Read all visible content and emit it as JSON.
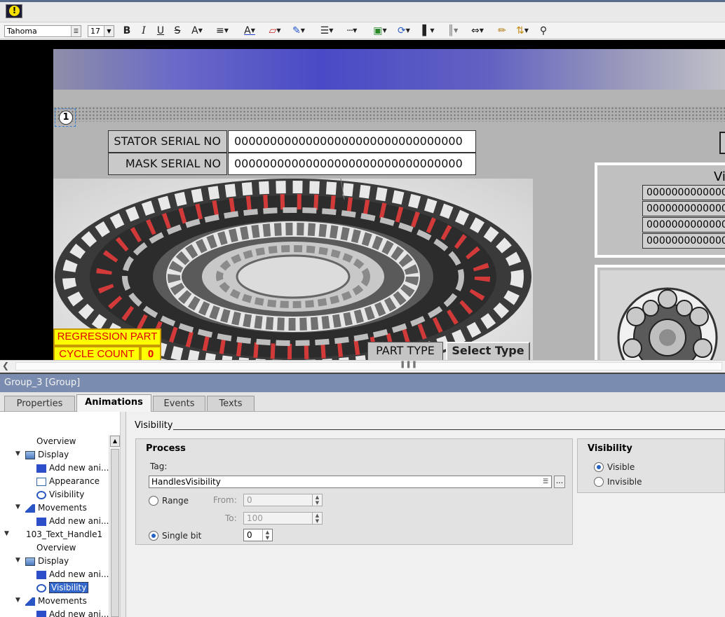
{
  "toolbar": {
    "font_name": "Tahoma",
    "font_size": "17",
    "bold": "B",
    "italic": "I",
    "underline": "U",
    "strike": "S",
    "text_size": "A",
    "text_color": "A"
  },
  "hmi": {
    "screen_number": "1",
    "stator_serial_label": "STATOR SERIAL NO",
    "stator_serial_value": "00000000000000000000000000000000",
    "mask_serial_label": "MASK SERIAL NO",
    "mask_serial_value": "00000000000000000000000000000000",
    "regression_label": "REGRESSION PART",
    "cycle_count_label": "CYCLE COUNT",
    "cycle_count_value": "0",
    "part_type_label": "PART TYPE",
    "select_type_label": "Select Type",
    "right_panel_title": "Vi",
    "right_panel_rows": [
      "00000000000000",
      "00000000000000",
      "00000000000000",
      "00000000000000"
    ]
  },
  "inspector": {
    "title": "Group_3 [Group]",
    "tabs": [
      "Properties",
      "Animations",
      "Events",
      "Texts"
    ],
    "active_tab": "Animations"
  },
  "tree": {
    "items": [
      {
        "label": "Overview"
      },
      {
        "label": "Display"
      },
      {
        "label": "Add new ani..."
      },
      {
        "label": "Appearance"
      },
      {
        "label": "Visibility"
      },
      {
        "label": "Movements"
      },
      {
        "label": "Add new ani..."
      },
      {
        "label": "103_Text_Handle1"
      },
      {
        "label": "Overview"
      },
      {
        "label": "Display"
      },
      {
        "label": "Add new ani..."
      },
      {
        "label": "Visibility"
      },
      {
        "label": "Movements"
      },
      {
        "label": "Add new ani..."
      }
    ]
  },
  "visibility_panel": {
    "section_title": "Visibility",
    "process_title": "Process",
    "tag_label": "Tag:",
    "tag_value": "HandlesVisibility",
    "range_label": "Range",
    "from_label": "From:",
    "from_value": "0",
    "to_label": "To:",
    "to_value": "100",
    "single_bit_label": "Single bit",
    "single_bit_value": "0",
    "mode_selected": "Single bit",
    "vis_box_title": "Visibility",
    "visible_label": "Visible",
    "invisible_label": "Invisible",
    "visibility_selected": "Visible"
  },
  "colors": {
    "inspector_title_bg": "#7a8db0",
    "selection": "#3367c9",
    "regression_bg": "#ffff00",
    "regression_text": "#e00000"
  }
}
